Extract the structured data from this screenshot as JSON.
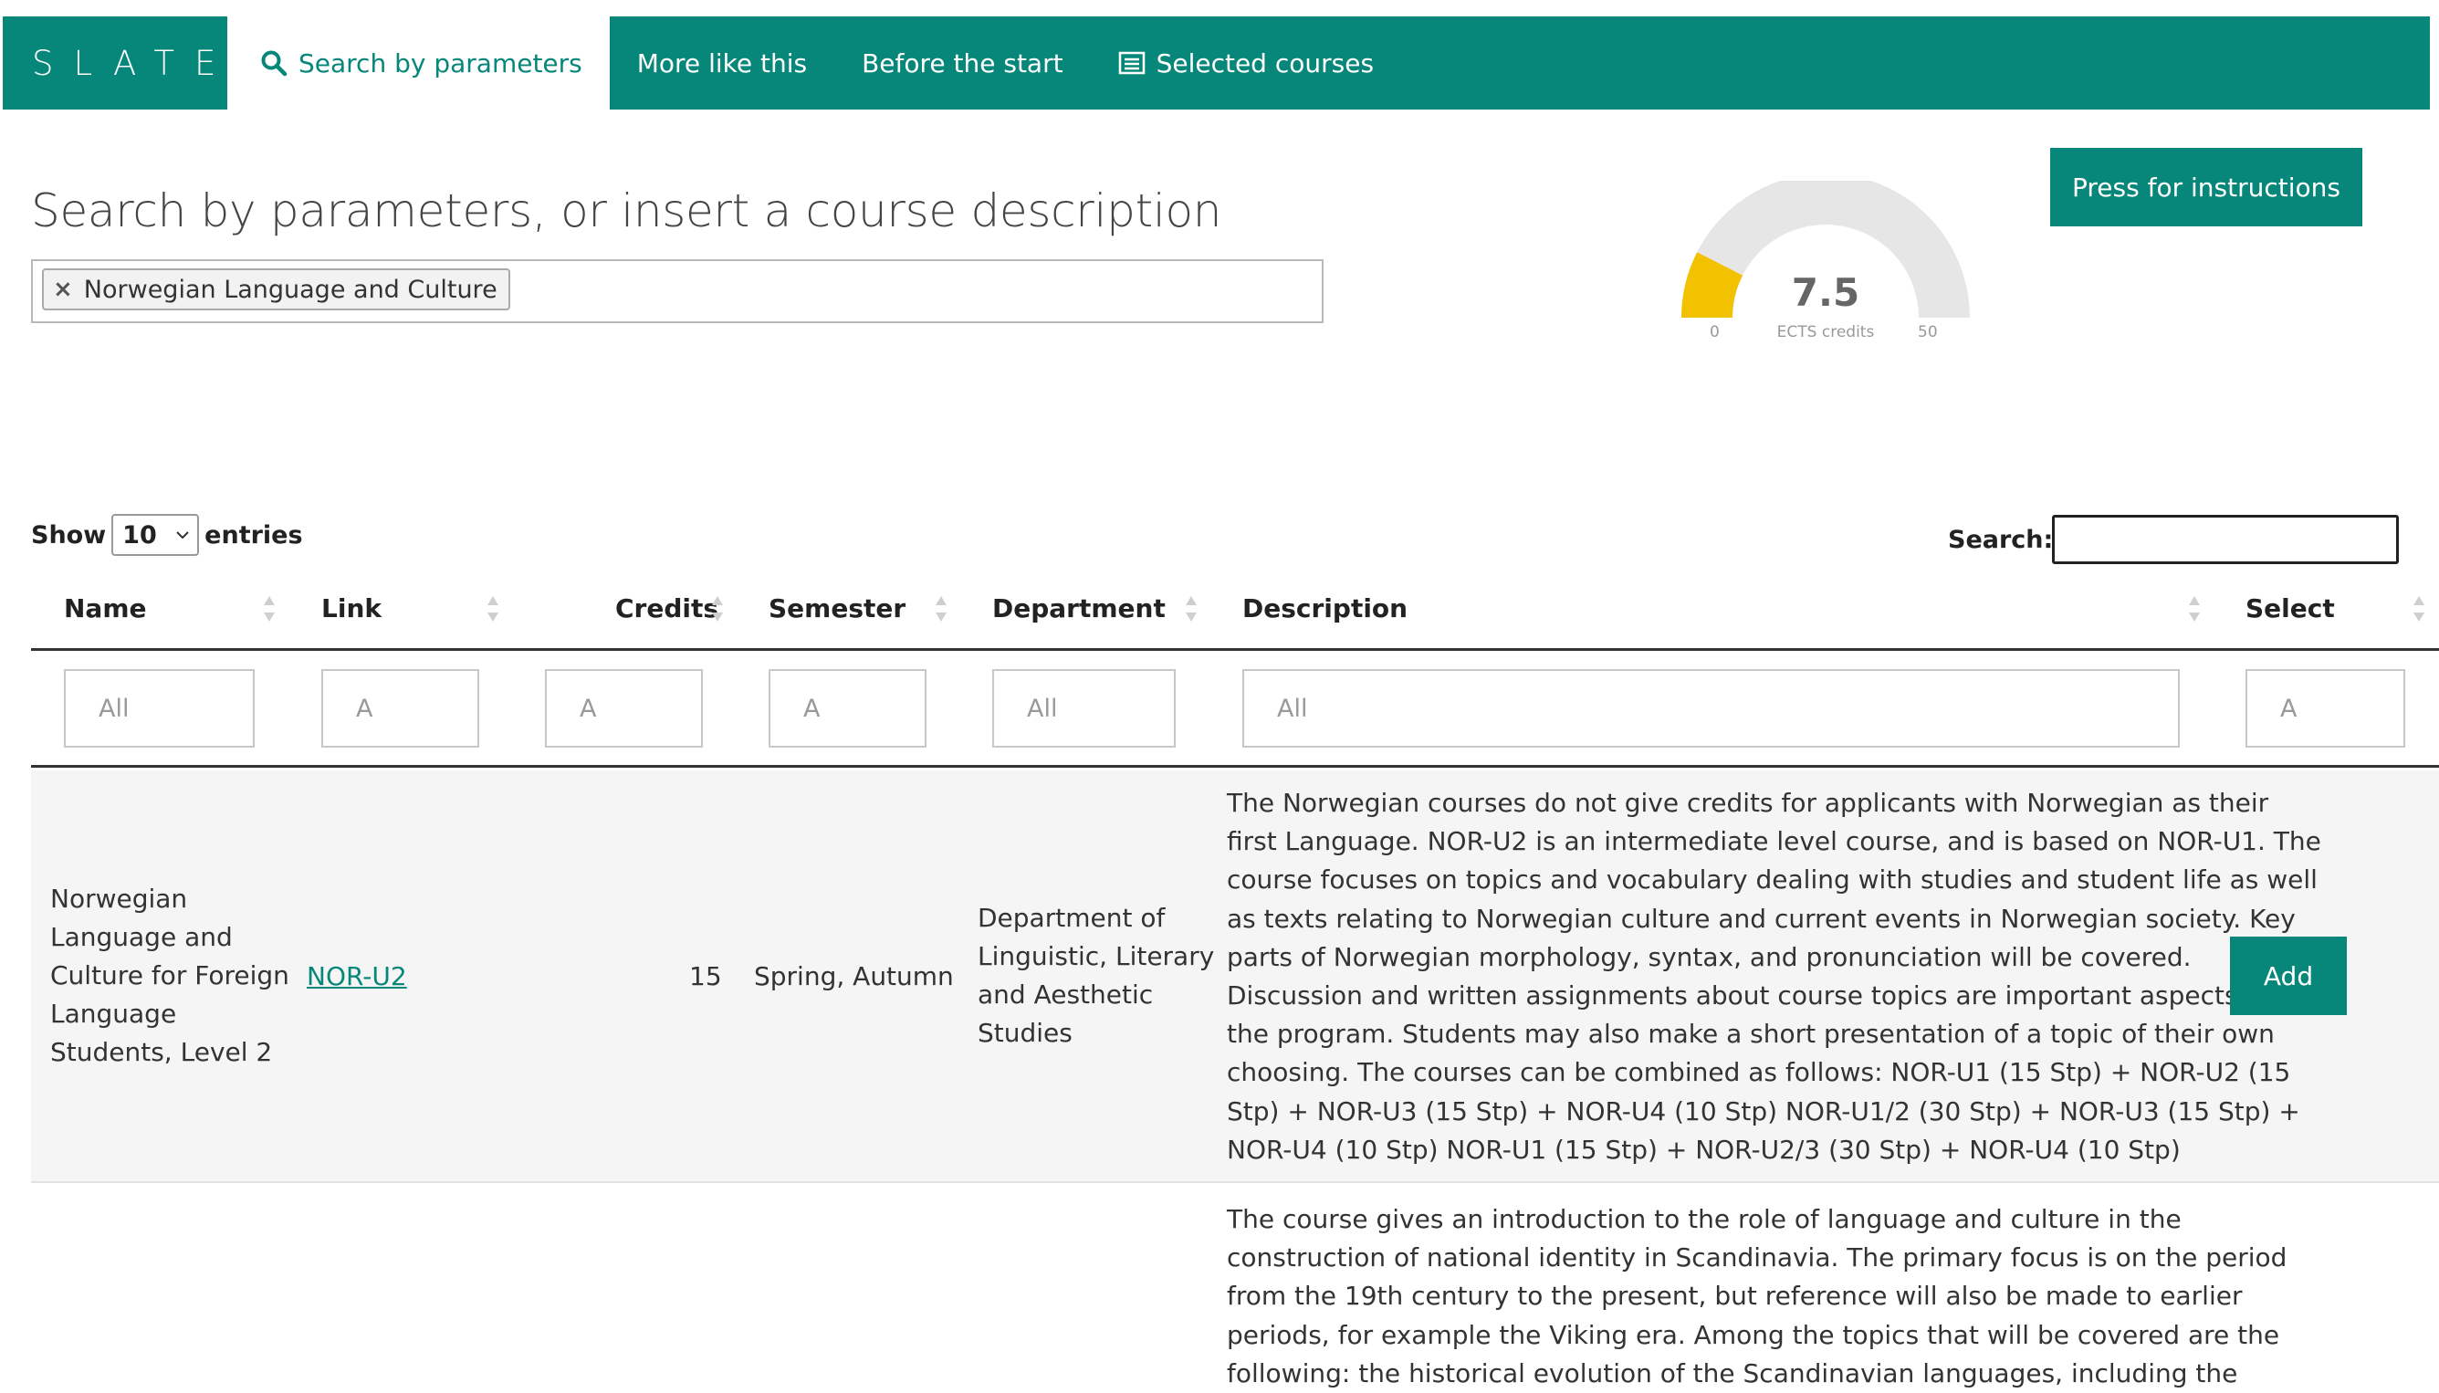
{
  "brand": {
    "name": "SLATE"
  },
  "nav": {
    "items": [
      {
        "label": "Search by parameters",
        "icon": "search-icon",
        "active": true
      },
      {
        "label": "More like this"
      },
      {
        "label": "Before the start"
      },
      {
        "label": "Selected courses",
        "icon": "list-icon"
      }
    ]
  },
  "header": {
    "title": "Search by parameters, or insert a course description",
    "tags": [
      "Norwegian Language and Culture"
    ],
    "tag_remove": "×"
  },
  "gauge": {
    "value": "7.5",
    "unit": "ECTS credits",
    "min": "0",
    "max": "50",
    "fraction": 0.15,
    "color": "#f2c200"
  },
  "instructions_button": "Press for instructions",
  "table_controls": {
    "show_label": "Show",
    "entries_value": "10",
    "entries_label": "entries",
    "search_label": "Search:",
    "search_value": ""
  },
  "table": {
    "columns": [
      "Name",
      "Link",
      "Credits",
      "Semester",
      "Department",
      "Description",
      "Select"
    ],
    "filters": [
      "All",
      "A",
      "A",
      "A",
      "All",
      "All",
      "A"
    ],
    "rows": [
      {
        "name_lines": [
          "Norwegian",
          "Language and",
          "Culture for Foreign",
          "Language",
          "Students, Level 2"
        ],
        "link": "NOR-U2",
        "credits": "15",
        "semester": "Spring, Autumn",
        "department_lines": [
          "Department of",
          "Linguistic, Literary",
          "and Aesthetic",
          "Studies"
        ],
        "description_lines": [
          "The Norwegian courses do not give credits for applicants with Norwegian as their",
          "first Language. NOR-U2 is an intermediate level course, and is based on NOR-U1. The",
          "course focuses on topics and vocabulary dealing with studies and student life as well",
          "as texts relating to Norwegian culture and current events in Norwegian society. Key",
          "parts of Norwegian morphology, syntax, and pronunciation will be covered.",
          "Discussion and written assignments about course topics are important aspects of",
          "the program. Students may also make a short presentation of a topic of their own",
          "choosing. The courses can be combined as follows: NOR-U1 (15 Stp) + NOR-U2 (15",
          "Stp) + NOR-U3 (15 Stp) + NOR-U4 (10 Stp) NOR-U1/2 (30 Stp) + NOR-U3 (15 Stp) +",
          "NOR-U4 (10 Stp) NOR-U1 (15 Stp) + NOR-U2/3 (30 Stp) + NOR-U4 (10 Stp)"
        ],
        "select_label": "Add"
      },
      {
        "description_lines": [
          "The course gives an introduction to the role of language and culture in the",
          "construction of national identity in Scandinavia. The primary focus is on the period",
          "from the 19th century to the present, but reference will also be made to earlier",
          "periods, for example the Viking era. Among the topics that will be covered are the",
          "following: the historical evolution of the Scandinavian languages, including the"
        ]
      }
    ]
  },
  "colors": {
    "primary": "#07877a",
    "gauge_fill": "#f2c200",
    "gauge_track": "#e6e6e6"
  }
}
